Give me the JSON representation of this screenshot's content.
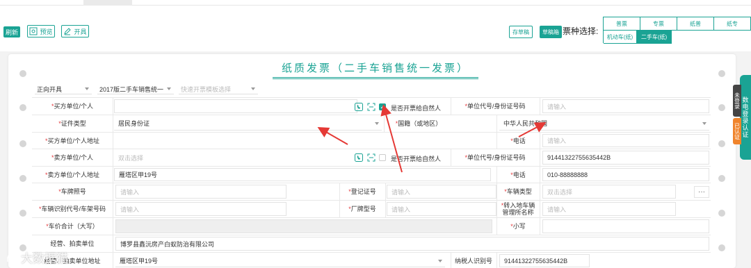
{
  "toolbar": {
    "refresh": "刷新",
    "preview": "预览",
    "issue": "开具",
    "save_draft": "存草稿",
    "draft_box": "草稿箱",
    "ticket_type_label": "票种选择:"
  },
  "ticket_types": {
    "row1": [
      "普票",
      "专票",
      "纸普",
      "纸专"
    ],
    "row2": [
      "机动车(纸)",
      "二手车(纸)"
    ],
    "active": "二手车(纸)"
  },
  "form": {
    "title": "纸质发票（二手车销售统一发票）",
    "selects": {
      "direction": "正向开具",
      "version": "2017版二手车销售统一",
      "template": "快速开票模板选择"
    },
    "natural_person_label": "是否开票给自然人",
    "rows": {
      "buyer": {
        "label": "买方单位/个人",
        "id_label": "单位代号/身份证号码",
        "id_placeholder": "请输入"
      },
      "cert": {
        "label": "证件类型",
        "value": "居民身份证",
        "nationality_label": "国籍（或地区）",
        "nationality_value": "中华人民共和国"
      },
      "buyer_addr": {
        "label": "买方单位/个人地址",
        "phone_label": "电话",
        "phone_placeholder": "请输入"
      },
      "seller": {
        "label": "卖方单位/个人",
        "placeholder": "双击选择",
        "id_label": "单位代号/身份证号码",
        "id_value": "91441322755635442B"
      },
      "seller_addr": {
        "label": "卖方单位/个人地址",
        "value": "雁塔区甲19号",
        "phone_label": "电话",
        "phone_value": "010-88888888"
      },
      "plate": {
        "label": "车牌照号",
        "placeholder": "请输入",
        "reg_label": "登记证号",
        "reg_placeholder": "请输入",
        "type_label": "车辆类型",
        "type_placeholder": "双击选择",
        "more": "···"
      },
      "vin": {
        "label": "车辆识别代号/车架号码",
        "placeholder": "请输入",
        "model_label": "厂牌型号",
        "model_placeholder": "请输入",
        "transfer_label_1": "转入地车辆",
        "transfer_label_2": "管理所名称",
        "transfer_placeholder": "请输入"
      },
      "price": {
        "label": "车价合计（大写）",
        "small_label": "小写"
      },
      "auction": {
        "label": "经营、拍卖单位",
        "value": "博罗县鑫沅房产白蚁防治有限公司"
      },
      "auction_addr": {
        "label": "经营、拍卖单位地址",
        "value": "雁塔区甲19号",
        "tax_label": "纳税人识别号",
        "tax_value": "91441322755635442B"
      }
    }
  },
  "side": {
    "dark": "未登录",
    "orange": "已认证",
    "green": "数电登录认证"
  },
  "watermark": "大数据猫",
  "colors": {
    "accent": "#1aa394",
    "required": "#e4393c",
    "arrow": "#e53935"
  }
}
